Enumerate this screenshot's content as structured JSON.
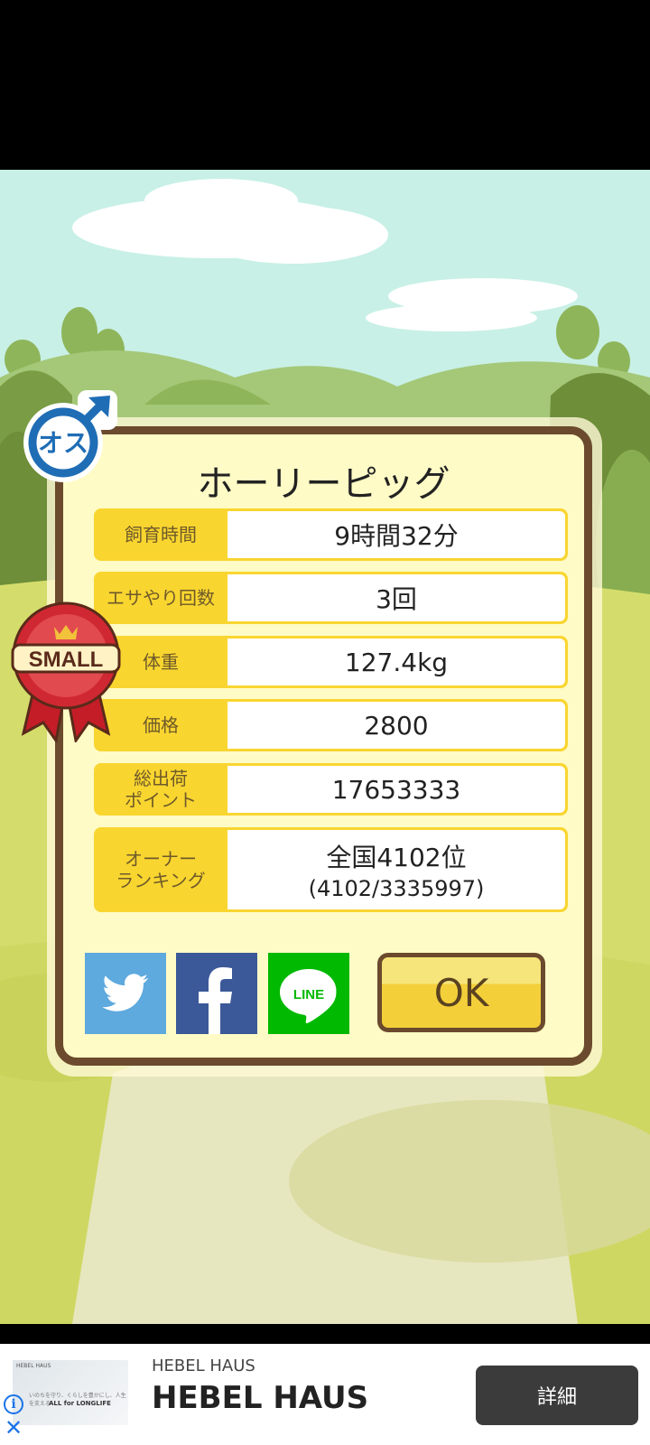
{
  "dialog": {
    "title": "ホーリーピッグ",
    "stats": [
      {
        "label": "飼育時間",
        "value": "9時間32分"
      },
      {
        "label": "エサやり回数",
        "value": "3回"
      },
      {
        "label": "体重",
        "value": "127.4kg"
      },
      {
        "label": "価格",
        "value": "2800"
      },
      {
        "label": "総出荷\nポイント",
        "value": "17653333"
      },
      {
        "label": "オーナー\nランキング",
        "value": "全国4102位",
        "sub": "(4102/3335997)"
      }
    ],
    "ok_label": "OK",
    "share": {
      "line_label": "LINE"
    }
  },
  "gender_badge": {
    "text": "オス",
    "icon": "male-symbol-icon"
  },
  "size_ribbon": {
    "text": "SMALL"
  },
  "ad": {
    "thumb_brand": "HEBEL HAUS",
    "thumb_caption": "いのちを守り、くらしを豊かにし、人生を支える",
    "thumb_tagline": "ALL for LONGLIFE",
    "subtitle": "HEBEL HAUS",
    "title": "HEBEL HAUS",
    "button_label": "詳細",
    "info_symbol": "i",
    "close_symbol": "✕"
  },
  "colors": {
    "panel_border": "#6b4a2d",
    "panel_bg": "#fffbc6",
    "label_bg": "#f9d530",
    "twitter": "#5ea9dd",
    "facebook": "#3b5998",
    "line": "#00b900"
  }
}
